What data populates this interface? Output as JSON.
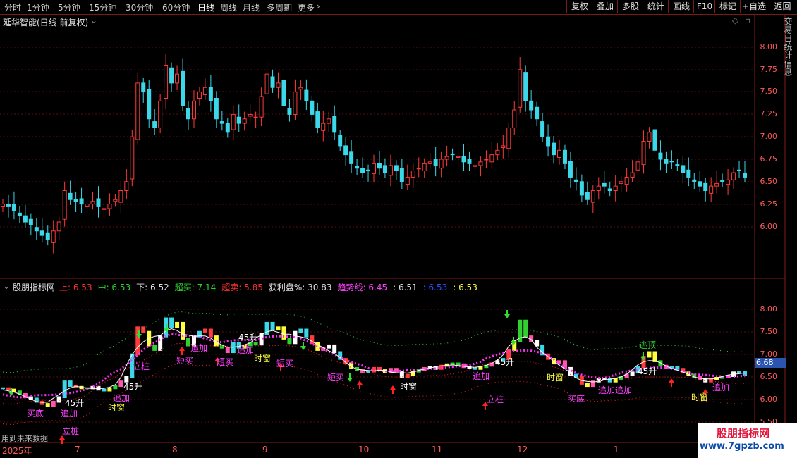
{
  "toolbar": {
    "periods": [
      "分时",
      "1分钟",
      "5分钟",
      "15分钟",
      "30分钟",
      "60分钟",
      "日线",
      "周线",
      "月线",
      "多周期",
      "更多"
    ],
    "active_period": "日线",
    "buttons": [
      "复权",
      "叠加",
      "多股",
      "统计",
      "画线",
      "F10",
      "标记",
      "+自选",
      "返回"
    ]
  },
  "main_panel": {
    "title": "延华智能(日线 前复权)",
    "y_ticks": [
      "8.00",
      "7.75",
      "7.50",
      "7.25",
      "7.00",
      "6.75",
      "6.50",
      "6.25",
      "6.00"
    ],
    "right_strip_chars": "交易日统计信息"
  },
  "indicator_panel": {
    "name": "股朋指标网",
    "values": [
      {
        "label": "上:",
        "value": "6.53",
        "color": "#ff3030"
      },
      {
        "label": "中:",
        "value": "6.53",
        "color": "#30d030"
      },
      {
        "label": "下:",
        "value": "6.52",
        "color": "#e0e0e0"
      },
      {
        "label": "超买:",
        "value": "7.14",
        "color": "#30d030"
      },
      {
        "label": "超卖:",
        "value": "5.85",
        "color": "#ff3030"
      },
      {
        "label": "获利盘%:",
        "value": "30.83",
        "color": "#e0e0e0"
      },
      {
        "label": "趋势线:",
        "value": "6.45",
        "color": "#ff40ff"
      },
      {
        "label": ":",
        "value": "6.51",
        "color": "#e0e0e0"
      },
      {
        "label": ":",
        "value": "6.53",
        "color": "#3050ff"
      },
      {
        "label": ":",
        "value": "6.53",
        "color": "#ffff40"
      }
    ],
    "y_ticks": [
      "8.00",
      "7.50",
      "7.00",
      "6.50",
      "6.00",
      "5.50"
    ],
    "current_price": "6.68",
    "signals": [
      {
        "text": "买底",
        "color": "#ff40ff"
      },
      {
        "text": "追加",
        "color": "#ff40ff"
      },
      {
        "text": "立桩",
        "color": "#ff40ff"
      },
      {
        "text": "45升",
        "color": "#ffffff"
      },
      {
        "text": "时窗",
        "color": "#ffff40"
      },
      {
        "text": "追加",
        "color": "#ff40ff"
      },
      {
        "text": "45升",
        "color": "#ffffff"
      },
      {
        "text": "立桩",
        "color": "#ff40ff"
      },
      {
        "text": "短买",
        "color": "#ff40ff"
      },
      {
        "text": "追加",
        "color": "#ff40ff"
      },
      {
        "text": "短买",
        "color": "#ff40ff"
      },
      {
        "text": "45升",
        "color": "#ffffff"
      },
      {
        "text": "追加",
        "color": "#ff40ff"
      },
      {
        "text": "时窗",
        "color": "#ffff40"
      },
      {
        "text": "短买",
        "color": "#ff40ff"
      },
      {
        "text": "短买",
        "color": "#ff40ff"
      },
      {
        "text": "时窗",
        "color": "#ffffff"
      },
      {
        "text": "追加",
        "color": "#ff40ff"
      },
      {
        "text": "立桩",
        "color": "#ff40ff"
      },
      {
        "text": "45升",
        "color": "#ffffff"
      },
      {
        "text": "时窗",
        "color": "#ffff40"
      },
      {
        "text": "买底",
        "color": "#ff40ff"
      },
      {
        "text": "追加追加",
        "color": "#ff40ff"
      },
      {
        "text": "逃顶",
        "color": "#30d030"
      },
      {
        "text": "45升",
        "color": "#ffffff"
      },
      {
        "text": "时窗",
        "color": "#ffff40"
      },
      {
        "text": "追加",
        "color": "#ff40ff"
      }
    ]
  },
  "x_axis": {
    "labels": [
      "2025年",
      "7",
      "8",
      "9",
      "10",
      "11",
      "12",
      "1"
    ]
  },
  "footer_text": "用到未来数据",
  "watermark": {
    "line1": "股朋指标网",
    "line2": "www.7gpzb.com"
  }
}
